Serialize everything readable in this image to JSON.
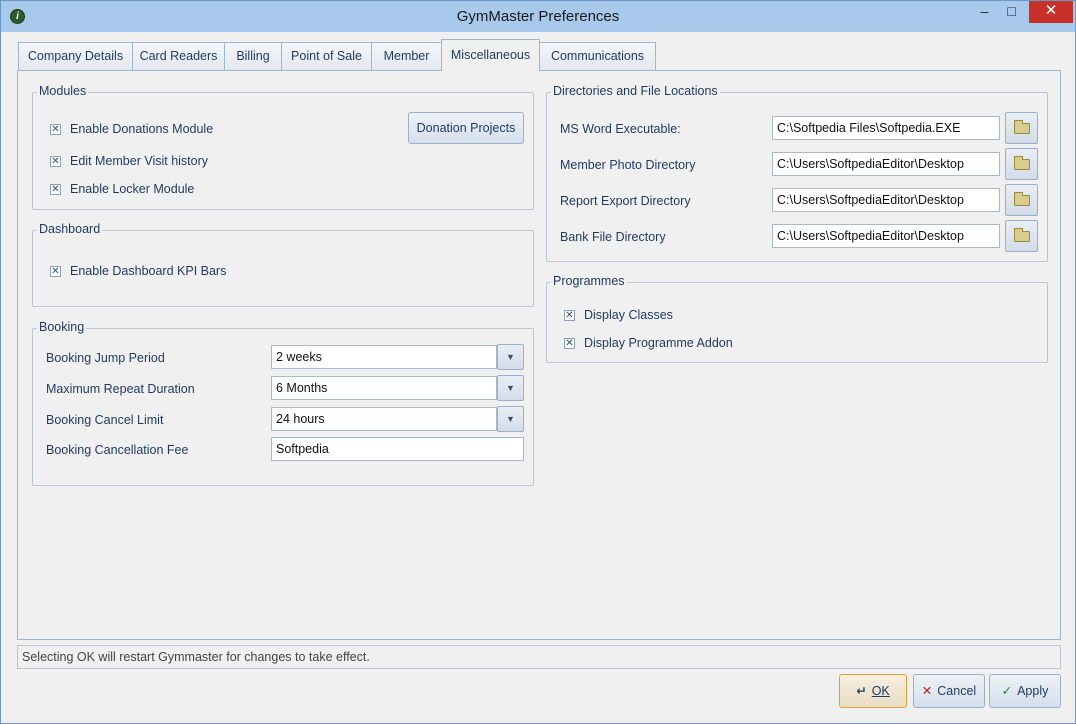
{
  "window": {
    "title": "GymMaster Preferences",
    "icon": "gymmaster-app-icon",
    "minimize": "–",
    "maximize": "□",
    "close": "✕"
  },
  "tabs": [
    {
      "label": "Company Details",
      "active": false
    },
    {
      "label": "Card Readers",
      "active": false
    },
    {
      "label": "Billing",
      "active": false
    },
    {
      "label": "Point of Sale",
      "active": false
    },
    {
      "label": "Member",
      "active": false
    },
    {
      "label": "Miscellaneous",
      "active": true
    },
    {
      "label": "Communications",
      "active": false
    }
  ],
  "modules": {
    "title": "Modules",
    "items": [
      {
        "label": "Enable Donations Module",
        "checked": true
      },
      {
        "label": "Edit Member Visit history",
        "checked": true
      },
      {
        "label": "Enable Locker Module",
        "checked": true
      }
    ],
    "donation_button": "Donation Projects"
  },
  "dashboard": {
    "title": "Dashboard",
    "items": [
      {
        "label": "Enable Dashboard KPI Bars",
        "checked": true
      }
    ]
  },
  "booking": {
    "title": "Booking",
    "rows": [
      {
        "label": "Booking Jump Period",
        "value": "2 weeks",
        "type": "dropdown"
      },
      {
        "label": "Maximum Repeat Duration",
        "value": "6 Months",
        "type": "dropdown"
      },
      {
        "label": "Booking Cancel Limit",
        "value": "24 hours",
        "type": "dropdown"
      },
      {
        "label": "Booking Cancellation Fee",
        "value": "Softpedia",
        "type": "text"
      }
    ]
  },
  "directories": {
    "title": "Directories and File Locations",
    "rows": [
      {
        "label": "MS Word Executable:",
        "value": "C:\\Softpedia Files\\Softpedia.EXE"
      },
      {
        "label": "Member Photo Directory",
        "value": "C:\\Users\\SoftpediaEditor\\Desktop"
      },
      {
        "label": "Report Export Directory",
        "value": "C:\\Users\\SoftpediaEditor\\Desktop"
      },
      {
        "label": "Bank File Directory",
        "value": "C:\\Users\\SoftpediaEditor\\Desktop"
      }
    ]
  },
  "programmes": {
    "title": "Programmes",
    "items": [
      {
        "label": "Display Classes",
        "checked": true
      },
      {
        "label": "Display Programme Addon",
        "checked": true
      }
    ]
  },
  "status_text": "Selecting OK will restart Gymmaster for changes to take effect.",
  "buttons": {
    "ok": "OK",
    "cancel": "Cancel",
    "apply": "Apply"
  },
  "check_mark": "✕",
  "dropdown_arrow": "▼"
}
